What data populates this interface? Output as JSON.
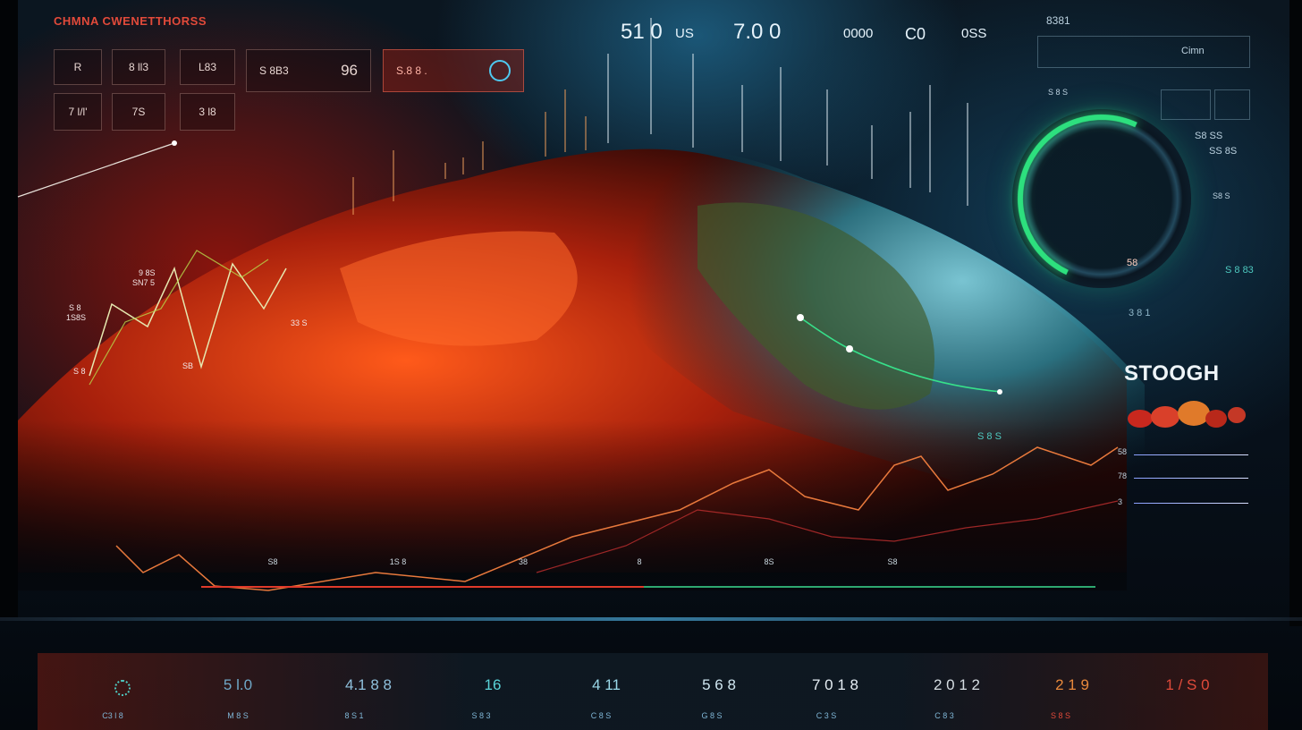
{
  "header": {
    "title": "CHMNA CWENETTHORSS",
    "top_stats": [
      "51 0",
      "US",
      "7.0 0",
      "0000",
      "C0",
      "0SS"
    ],
    "corner_code": "8381"
  },
  "left_panel": {
    "row1": [
      "R",
      "8 ll3",
      "L83",
      "S 8B3",
      "96",
      "S.8 8 ."
    ],
    "row2": [
      "7 l/l'",
      "7S",
      "3 l8"
    ]
  },
  "chart_labels": [
    "9 8S",
    "SN7 5",
    "S 8",
    "1S8S",
    "S 8",
    "33 S",
    "SB"
  ],
  "right_panel": {
    "box_label": "Cimn",
    "small_labels": [
      "S 8 S",
      "S8 SS",
      "SS 8S",
      "S8 S",
      "S 8 83",
      "3 8 1",
      "S 8 S"
    ],
    "gauge_value": "58",
    "stough_label": "STOOGH",
    "list_labels": [
      "58",
      "78",
      "3"
    ]
  },
  "axis_labels": [
    "S8",
    "1S 8",
    "38",
    "8",
    "8S",
    "S8"
  ],
  "bottom_stats": [
    {
      "value": "5 l.0",
      "label": "C3 l 8"
    },
    {
      "value": "4.1 8 8",
      "label": "M 8 S"
    },
    {
      "value": "16",
      "label": "8 S 1"
    },
    {
      "value": "4 11",
      "label": "S 8 3"
    },
    {
      "value": "5 6 8",
      "label": "C 8 S"
    },
    {
      "value": "7 0 1 8",
      "label": "G 8 S"
    },
    {
      "value": "2 0 1 2",
      "label": "C 3 S"
    },
    {
      "value": "2 1 9",
      "label": "C 8 3"
    },
    {
      "value": "1 / S 0",
      "label": "S 8 S"
    }
  ],
  "colors": {
    "accent_red": "#e24a3a",
    "accent_cyan": "#4ec9f0",
    "accent_green": "#2de07e",
    "accent_orange": "#e8793c"
  }
}
